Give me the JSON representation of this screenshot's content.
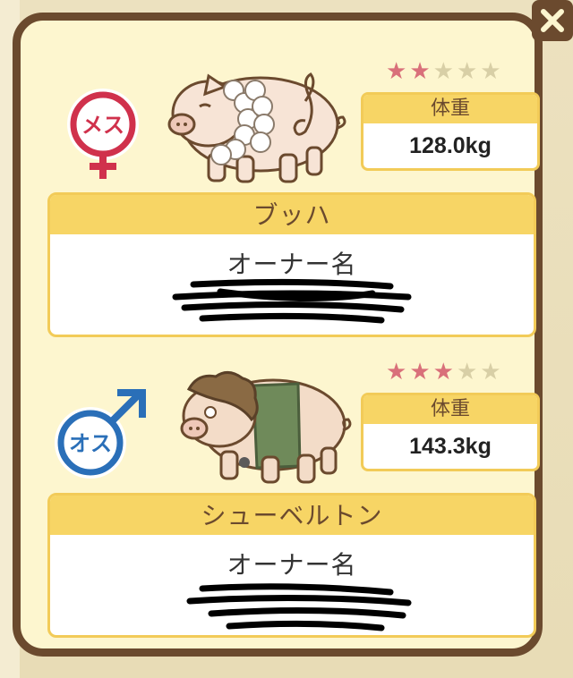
{
  "close": {
    "icon": "close-icon"
  },
  "pigs": [
    {
      "gender_label": "メス",
      "gender_color": "#d0314c",
      "stars": [
        "★",
        "★",
        "★",
        "★",
        "★"
      ],
      "filled_stars": 2,
      "weight_label": "体重",
      "weight": "128.0kg",
      "name": "ブッハ",
      "owner_label": "オーナー名"
    },
    {
      "gender_label": "オス",
      "gender_color": "#2a6fb8",
      "stars": [
        "★",
        "★",
        "★",
        "★",
        "★"
      ],
      "filled_stars": 3,
      "weight_label": "体重",
      "weight": "143.3kg",
      "name": "シューベルトン",
      "owner_label": "オーナー名"
    }
  ],
  "colors": {
    "star_on": "#d9707a",
    "star_off": "#d8cfa6",
    "frame": "#6b4a2e",
    "accent": "#f7d565"
  }
}
